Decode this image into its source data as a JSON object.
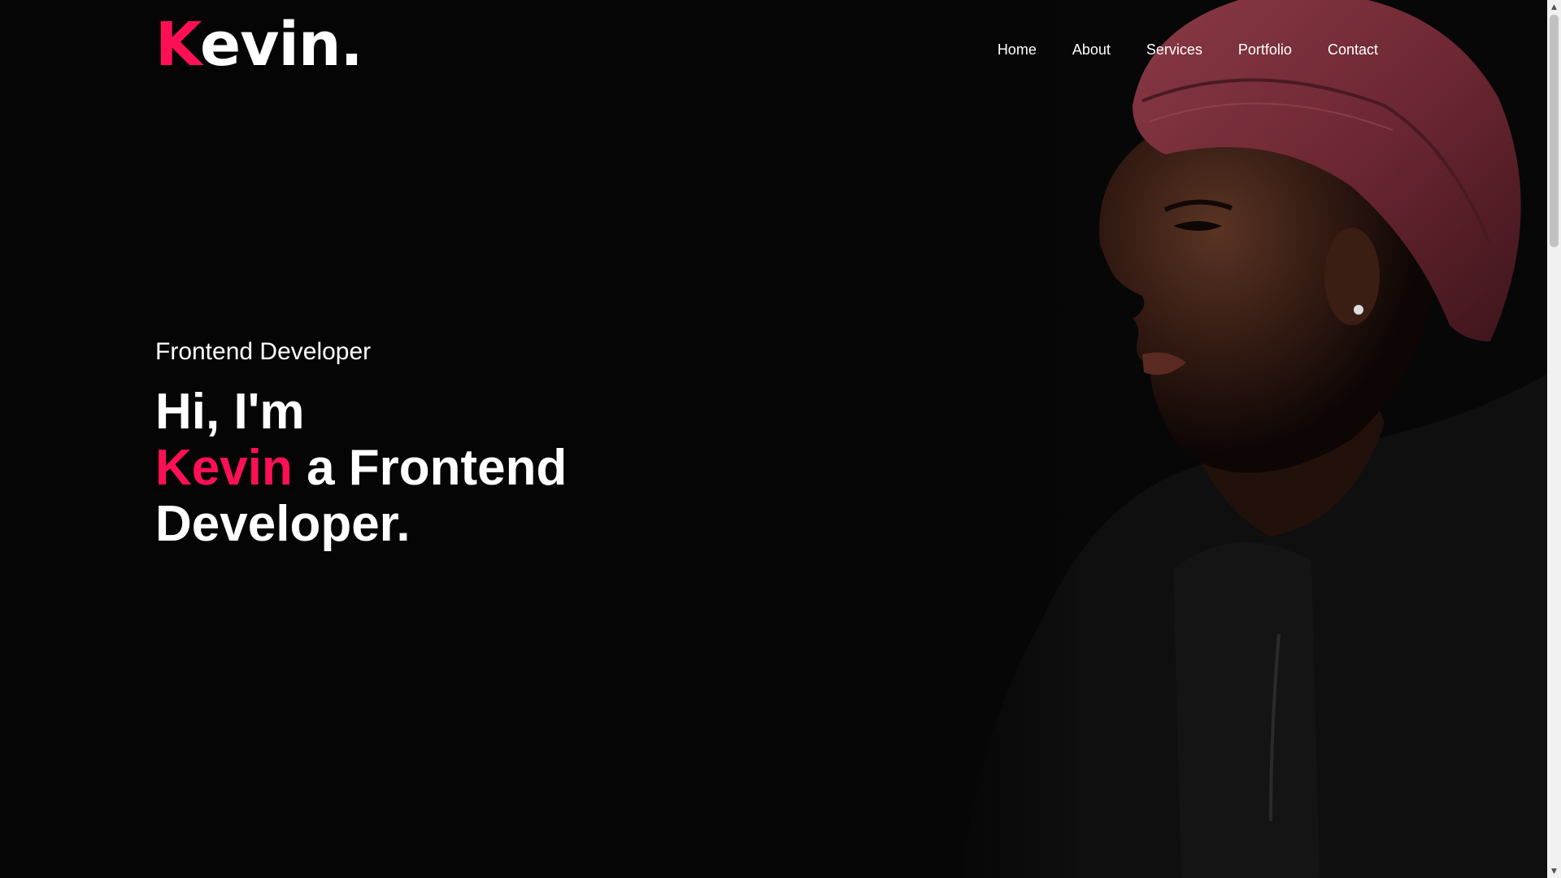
{
  "header": {
    "logo_initial": "K",
    "logo_rest": "evin",
    "logo_dot": ".",
    "nav": [
      {
        "label": "Home"
      },
      {
        "label": "About"
      },
      {
        "label": "Services"
      },
      {
        "label": "Portfolio"
      },
      {
        "label": "Contact"
      }
    ]
  },
  "hero": {
    "subtitle": "Frontend Developer",
    "line1": "Hi, I'm",
    "name": "Kevin",
    "line2_rest": " a Frontend",
    "line3": "Developer.",
    "photo_icon": "portrait-photo"
  },
  "colors": {
    "accent": "#ff1055",
    "background": "#050505",
    "text": "#ffffff"
  },
  "scrollbar": {
    "up_icon": "chevron-up-icon",
    "down_icon": "chevron-down-icon"
  }
}
